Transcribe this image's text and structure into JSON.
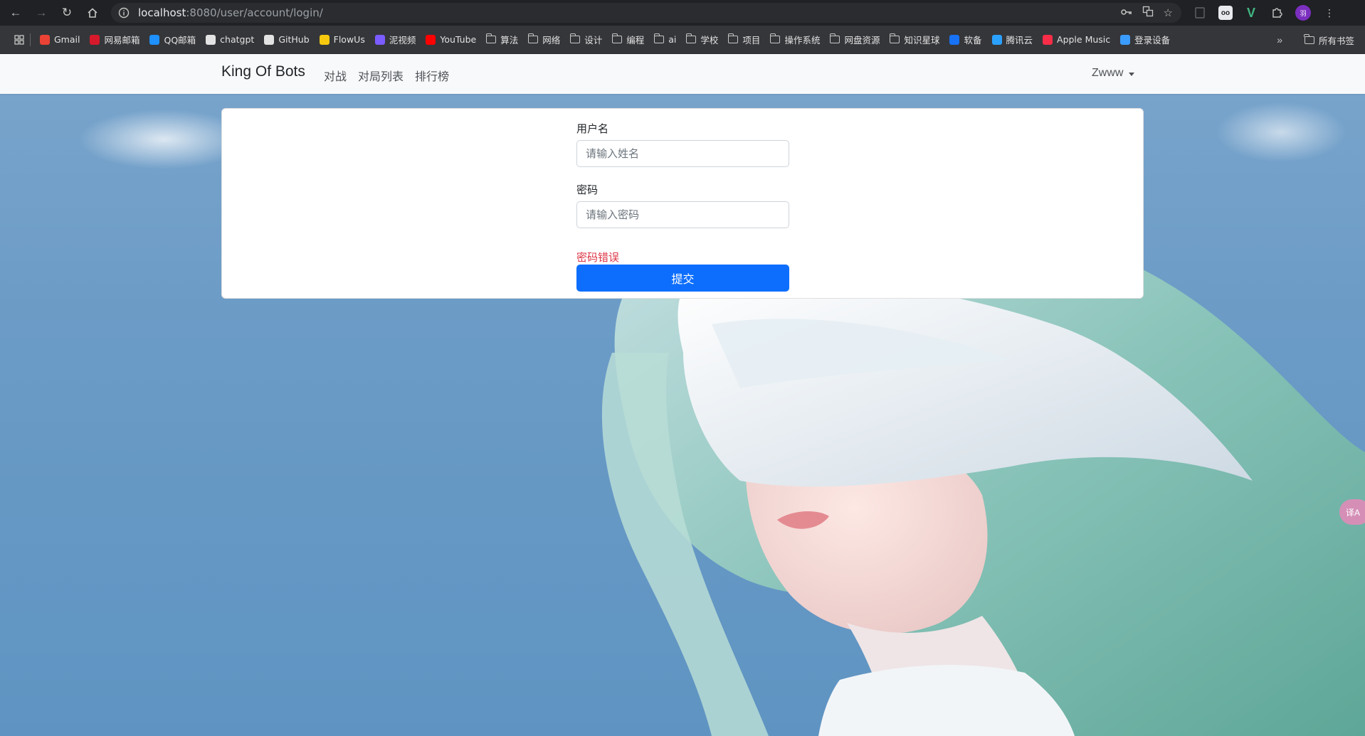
{
  "browser": {
    "url_host": "localhost",
    "url_rest": ":8080/user/account/login/",
    "bookmarks": [
      {
        "label": "Gmail",
        "icon": "gmail-icon",
        "color": "#ea4335"
      },
      {
        "label": "网易邮箱",
        "icon": "netease-mail-icon",
        "color": "#d7192c"
      },
      {
        "label": "QQ邮箱",
        "icon": "qq-mail-icon",
        "color": "#1e90ff"
      },
      {
        "label": "chatgpt",
        "icon": "chatgpt-icon",
        "color": "#e3e3e3"
      },
      {
        "label": "GitHub",
        "icon": "github-icon",
        "color": "#e3e3e3"
      },
      {
        "label": "FlowUs",
        "icon": "flowus-icon",
        "color": "#f6c90e"
      },
      {
        "label": "泥视频",
        "icon": "video-icon",
        "color": "#7a5cff"
      },
      {
        "label": "YouTube",
        "icon": "youtube-icon",
        "color": "#ff0000"
      },
      {
        "label": "算法",
        "icon": "folder-icon"
      },
      {
        "label": "网络",
        "icon": "folder-icon"
      },
      {
        "label": "设计",
        "icon": "folder-icon"
      },
      {
        "label": "编程",
        "icon": "folder-icon"
      },
      {
        "label": "ai",
        "icon": "folder-icon"
      },
      {
        "label": "学校",
        "icon": "folder-icon"
      },
      {
        "label": "项目",
        "icon": "folder-icon"
      },
      {
        "label": "操作系统",
        "icon": "folder-icon"
      },
      {
        "label": "网盘资源",
        "icon": "folder-icon"
      },
      {
        "label": "知识星球",
        "icon": "folder-icon"
      },
      {
        "label": "软备",
        "icon": "zhihu-icon",
        "color": "#1772f6"
      },
      {
        "label": "腾讯云",
        "icon": "tencent-cloud-icon",
        "color": "#2aa1ff"
      },
      {
        "label": "Apple Music",
        "icon": "apple-music-icon",
        "color": "#fa2d48"
      },
      {
        "label": "登录设备",
        "icon": "mi-icon",
        "color": "#3b9cff"
      }
    ],
    "all_bookmarks_label": "所有书签",
    "avatar_initial": "羽"
  },
  "navbar": {
    "brand": "King Of Bots",
    "links": [
      "对战",
      "对局列表",
      "排行榜"
    ],
    "user": "Zwww"
  },
  "login_form": {
    "username_label": "用户名",
    "username_placeholder": "请输入姓名",
    "username_value": "",
    "password_label": "密码",
    "password_placeholder": "请输入密码",
    "password_value": "",
    "error_message": "密码错误",
    "submit_label": "提交"
  },
  "translate_widget": {
    "label": "译A"
  },
  "colors": {
    "primary": "#0d6efd",
    "error": "#dc3545",
    "navbar_bg": "#f8f9fa"
  }
}
